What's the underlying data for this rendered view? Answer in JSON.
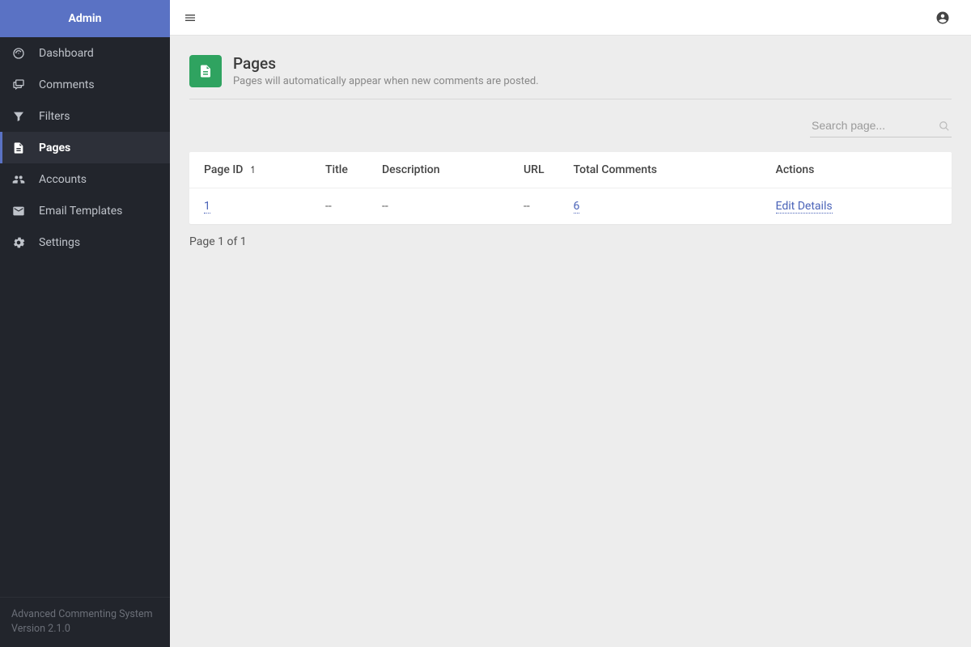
{
  "sidebar": {
    "brand": "Admin",
    "items": [
      {
        "label": "Dashboard"
      },
      {
        "label": "Comments"
      },
      {
        "label": "Filters"
      },
      {
        "label": "Pages"
      },
      {
        "label": "Accounts"
      },
      {
        "label": "Email Templates"
      },
      {
        "label": "Settings"
      }
    ],
    "footer_line1": "Advanced Commenting System",
    "footer_line2": "Version 2.1.0"
  },
  "page": {
    "title": "Pages",
    "subtitle": "Pages will automatically appear when new comments are posted.",
    "search_placeholder": "Search page...",
    "pagination": "Page 1 of 1"
  },
  "table": {
    "headers": {
      "page_id": "Page ID",
      "title": "Title",
      "description": "Description",
      "url": "URL",
      "total_comments": "Total Comments",
      "actions": "Actions"
    },
    "rows": [
      {
        "page_id": "1",
        "title": "--",
        "description": "--",
        "url": "--",
        "total_comments": "6",
        "action_label": "Edit Details"
      }
    ]
  }
}
